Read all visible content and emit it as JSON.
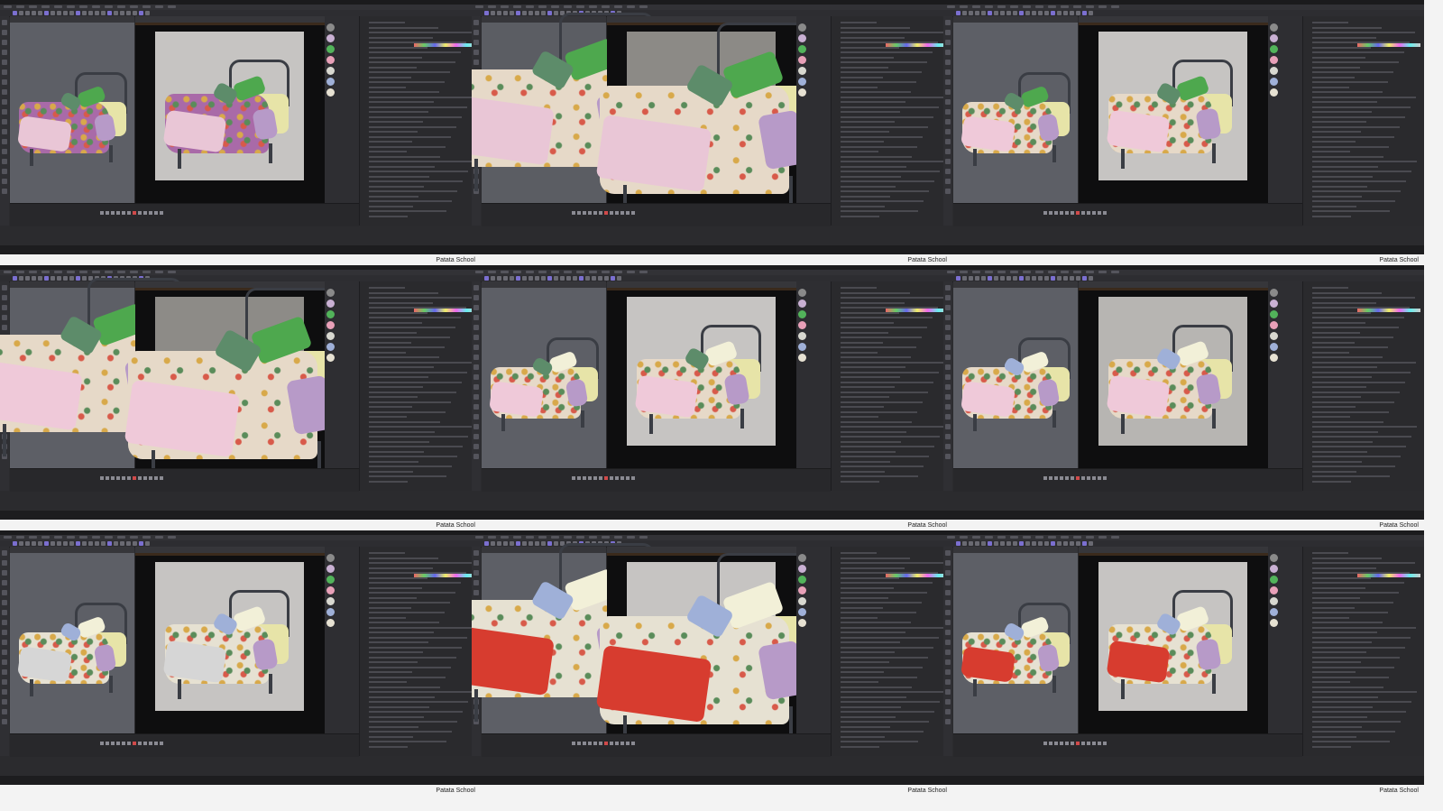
{
  "watermark": "Patata School",
  "frames": [
    {
      "id": 1,
      "viewport_bg": "#5d5f66",
      "preview_bg": "#c6c4c2",
      "bed_color": "#3a3d44",
      "blanket": "#a96aa8",
      "sheet": "#e9c6d6",
      "pillow": "#4ea84e",
      "pillow2": "#5d8c6a",
      "zoom": false
    },
    {
      "id": 2,
      "viewport_bg": "#5b5d63",
      "preview_bg": "#8c8a86",
      "bed_color": "#3a3d44",
      "blanket": "#e6d9c8",
      "sheet": "#e9c6d6",
      "pillow": "#4ea84e",
      "pillow2": "#5d8c6a",
      "zoom": true
    },
    {
      "id": 3,
      "viewport_bg": "#5d5f66",
      "preview_bg": "#c6c4c2",
      "bed_color": "#3a3d44",
      "blanket": "#e6d9c8",
      "sheet": "#efc9d9",
      "pillow": "#4ea84e",
      "pillow2": "#5d8c6a",
      "zoom": false
    },
    {
      "id": 4,
      "viewport_bg": "#5d5f66",
      "preview_bg": "#8d8b87",
      "bed_color": "#3a3d44",
      "blanket": "#e6d9c8",
      "sheet": "#efc9d9",
      "pillow": "#4ea84e",
      "pillow2": "#5d8c6a",
      "zoom": true
    },
    {
      "id": 5,
      "viewport_bg": "#5d5f66",
      "preview_bg": "#c6c4c2",
      "bed_color": "#3a3d44",
      "blanket": "#e6d9c8",
      "sheet": "#efc9d9",
      "pillow": "#f2f0d8",
      "pillow2": "#5d8c6a",
      "zoom": false
    },
    {
      "id": 6,
      "viewport_bg": "#5d5f66",
      "preview_bg": "#b7b5b2",
      "bed_color": "#3a3d44",
      "blanket": "#e6d9c8",
      "sheet": "#efc9d9",
      "pillow": "#f2f0d8",
      "pillow2": "#9fb0d8",
      "zoom": false
    },
    {
      "id": 7,
      "viewport_bg": "#5d5f66",
      "preview_bg": "#c6c4c2",
      "bed_color": "#3a3d44",
      "blanket": "#e6e1d2",
      "sheet": "#d6d6d6",
      "pillow": "#f2f0d8",
      "pillow2": "#9fb0d8",
      "zoom": false
    },
    {
      "id": 8,
      "viewport_bg": "#5d5f66",
      "preview_bg": "#c6c4c2",
      "bed_color": "#3a3d44",
      "blanket": "#e6e1d2",
      "sheet": "#d73c2f",
      "pillow": "#f2f0d8",
      "pillow2": "#9fb0d8",
      "zoom": true
    },
    {
      "id": 9,
      "viewport_bg": "#5d5f66",
      "preview_bg": "#c6c4c2",
      "bed_color": "#3a3d44",
      "blanket": "#e6e1d2",
      "sheet": "#d73c2f",
      "pillow": "#f2f0d8",
      "pillow2": "#9fb0d8",
      "zoom": false
    }
  ]
}
